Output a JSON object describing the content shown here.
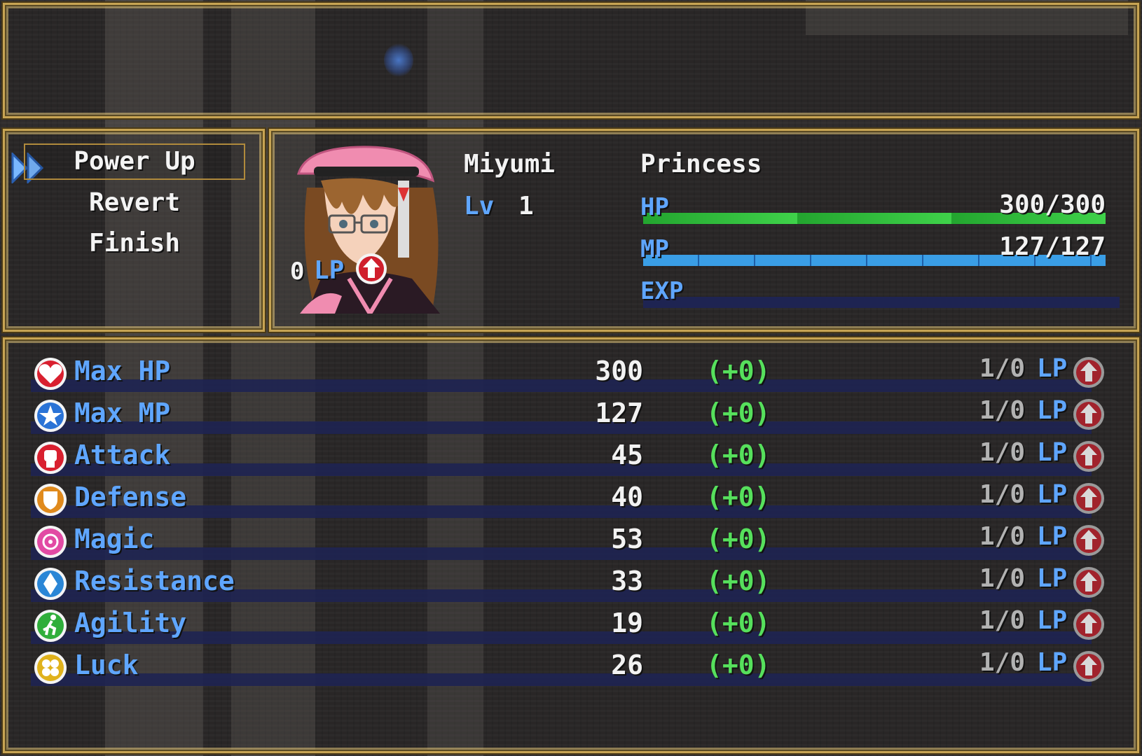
{
  "command_menu": {
    "items": [
      {
        "label": "Power Up",
        "selected": true
      },
      {
        "label": "Revert",
        "selected": false
      },
      {
        "label": "Finish",
        "selected": false
      }
    ]
  },
  "actor": {
    "name": "Miyumi",
    "class": "Princess",
    "level_label": "Lv",
    "level": "1",
    "lp": "0",
    "lp_label": "LP",
    "hp_label": "HP",
    "hp_text": "300/300",
    "hp_fraction": 1.0,
    "mp_label": "MP",
    "mp_text": "127/127",
    "mp_fraction": 1.0,
    "exp_label": "EXP",
    "exp_fraction": 0.0
  },
  "params": [
    {
      "name": "Max HP",
      "value": "300",
      "diff": "(+0)",
      "cost": "1/0",
      "lp_label": "LP",
      "icon": "heart-icon",
      "color": "#d9202f"
    },
    {
      "name": "Max MP",
      "value": "127",
      "diff": "(+0)",
      "cost": "1/0",
      "lp_label": "LP",
      "icon": "star-icon",
      "color": "#2a73d6"
    },
    {
      "name": "Attack",
      "value": "45",
      "diff": "(+0)",
      "cost": "1/0",
      "lp_label": "LP",
      "icon": "fist-icon",
      "color": "#d9202f"
    },
    {
      "name": "Defense",
      "value": "40",
      "diff": "(+0)",
      "cost": "1/0",
      "lp_label": "LP",
      "icon": "shield-icon",
      "color": "#e08a1c"
    },
    {
      "name": "Magic",
      "value": "53",
      "diff": "(+0)",
      "cost": "1/0",
      "lp_label": "LP",
      "icon": "magic-sparkle-icon",
      "color": "#e24aa4"
    },
    {
      "name": "Resistance",
      "value": "33",
      "diff": "(+0)",
      "cost": "1/0",
      "lp_label": "LP",
      "icon": "crystal-icon",
      "color": "#2a86d6"
    },
    {
      "name": "Agility",
      "value": "19",
      "diff": "(+0)",
      "cost": "1/0",
      "lp_label": "LP",
      "icon": "running-figure-icon",
      "color": "#2fae3a"
    },
    {
      "name": "Luck",
      "value": "26",
      "diff": "(+0)",
      "cost": "1/0",
      "lp_label": "LP",
      "icon": "clover-icon",
      "color": "#e0b21c"
    }
  ],
  "colors": {
    "frame": "#c7a453",
    "system_text": "#5fa6ff",
    "hp_gauge": "#2eb23a",
    "mp_gauge": "#3a9ee6",
    "gauge_back": "#1e2452",
    "increase_text": "#56e05c"
  }
}
